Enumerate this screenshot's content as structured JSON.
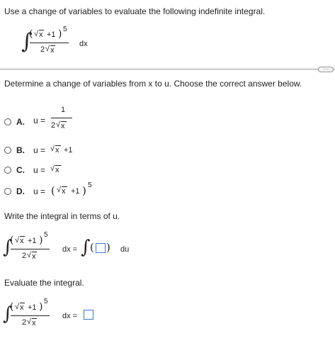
{
  "question": {
    "prompt": "Use a change of variables to evaluate the following indefinite integral.",
    "integrand": {
      "integral_sign": "∫",
      "num_open": "(",
      "num_radicand": "x",
      "num_plus_one": "+1",
      "num_close": ")",
      "exponent": "5",
      "den_coeff": "2",
      "den_radicand": "x",
      "dx": "dx"
    }
  },
  "more_button": {
    "label": "···"
  },
  "step1": {
    "instruction": "Determine a change of variables from x to u. Choose the correct answer below.",
    "options": [
      {
        "letter": "A.",
        "u_eq": "u =",
        "num": "1",
        "den_coeff": "2",
        "den_radicand": "x"
      },
      {
        "letter": "B.",
        "u_eq": "u =",
        "radicand": "x",
        "tail": "+1"
      },
      {
        "letter": "C.",
        "u_eq": "u =",
        "radicand": "x"
      },
      {
        "letter": "D.",
        "u_eq": "u =",
        "open": "(",
        "radicand": "x",
        "tail": "+1",
        "close": ")",
        "exponent": "5"
      }
    ]
  },
  "step2": {
    "instruction": "Write the integral in terms of u.",
    "dx_eq": "dx =",
    "integral_sign": "∫",
    "open": "(",
    "close": ")",
    "du": "du"
  },
  "step3": {
    "instruction": "Evaluate the integral.",
    "dx_eq": "dx ="
  },
  "colors": {
    "text": "#222222",
    "input_border": "#3a7bd5",
    "divider": "#9a9a9a",
    "radio_border": "#555555"
  },
  "icons": {
    "radio": "radio-button-icon",
    "more": "more-dots-icon"
  }
}
